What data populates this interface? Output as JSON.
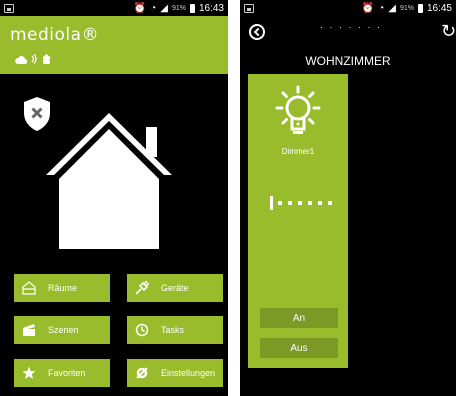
{
  "left_screen": {
    "status_bar": {
      "battery": "91%",
      "time": "16:43"
    },
    "logo": "mediola®",
    "menu": {
      "raeume": "Räume",
      "geraete": "Geräte",
      "szenen": "Szenen",
      "tasks": "Tasks",
      "favoriten": "Favoriten",
      "einstellungen": "Einstellungen"
    }
  },
  "right_screen": {
    "status_bar": {
      "battery": "91%",
      "time": "16:45"
    },
    "page_dots": "· · · · · · ·",
    "room_title": "WOHNZIMMER",
    "device": {
      "name": "Dimmer1",
      "dim_level": 0,
      "on_label": "An",
      "off_label": "Aus"
    }
  },
  "colors": {
    "accent": "#99bc2d",
    "button_dark": "#7b9a25",
    "background": "#000000"
  }
}
